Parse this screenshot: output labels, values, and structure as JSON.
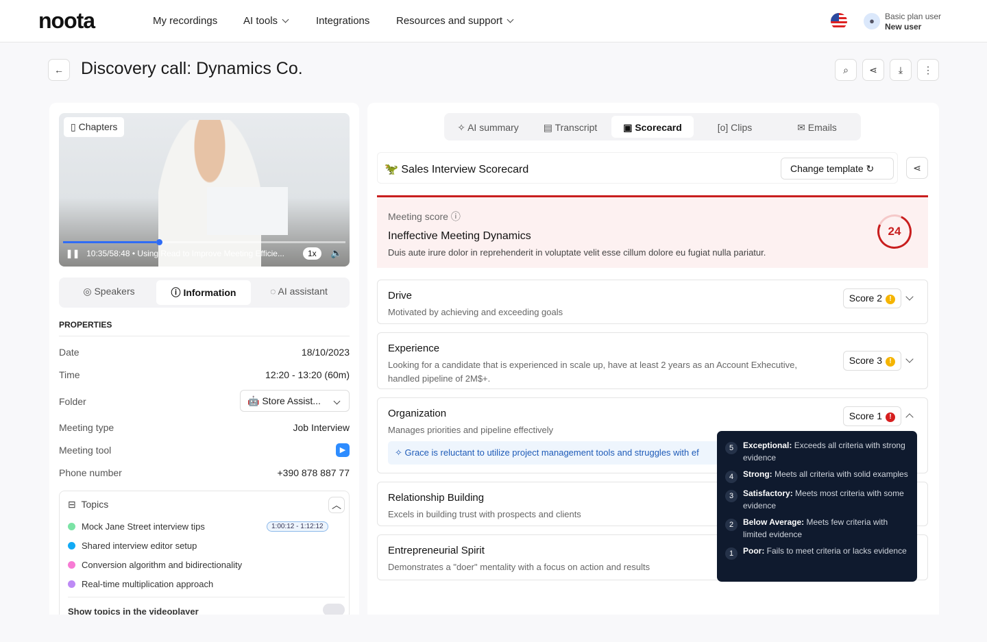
{
  "brand": {
    "logo": "noota"
  },
  "nav": {
    "items": [
      {
        "label": "My recordings"
      },
      {
        "label": "AI tools"
      },
      {
        "label": "Integrations"
      },
      {
        "label": "Resources and support"
      }
    ]
  },
  "user": {
    "plan": "Basic plan user",
    "name": "New user"
  },
  "page": {
    "title": "Discovery call: Dynamics Co."
  },
  "video": {
    "chapters_label": "Chapters",
    "time": "10:35/58:48",
    "separator": "•",
    "chapter_title": "Using Read to Improve Meeting Efficie...",
    "speed": "1x",
    "progress_percent": 33
  },
  "left_tabs": [
    {
      "label": "Speakers"
    },
    {
      "label": "Information"
    },
    {
      "label": "AI assistant"
    }
  ],
  "properties": {
    "heading": "PROPERTIES",
    "rows": [
      {
        "label": "Date",
        "value": "18/10/2023"
      },
      {
        "label": "Time",
        "value": "12:20 - 13:20 (60m)"
      },
      {
        "label": "Folder",
        "value": "Store Assist..."
      },
      {
        "label": "Meeting type",
        "value": "Job Interview"
      },
      {
        "label": "Meeting tool",
        "value": "zoom"
      },
      {
        "label": "Phone number",
        "value": "+390 878 887 77"
      }
    ]
  },
  "topics": {
    "title": "Topics",
    "items": [
      {
        "label": "Mock Jane Street interview tips",
        "color": "#7be3a5",
        "time": "1:00:12 - 1:12:12"
      },
      {
        "label": "Shared interview editor setup",
        "color": "#12aaf5"
      },
      {
        "label": "Conversion algorithm and bidirectionality",
        "color": "#f77bd4"
      },
      {
        "label": "Real-time multiplication approach",
        "color": "#bd8af5"
      }
    ],
    "show_label": "Show topics in the videoplayer",
    "show_enabled": false
  },
  "right_tabs": [
    {
      "label": "AI summary"
    },
    {
      "label": "Transcript"
    },
    {
      "label": "Scorecard",
      "active": true
    },
    {
      "label": "Clips"
    },
    {
      "label": "Emails"
    }
  ],
  "scorecard": {
    "title": "Sales Interview Scorecard",
    "change_template": "Change template",
    "meeting": {
      "label": "Meeting score",
      "headline": "Ineffective Meeting Dynamics",
      "description": "Duis aute irure dolor in reprehenderit in voluptate velit esse cillum dolore eu fugiat nulla pariatur.",
      "score": "24",
      "color": "#c81e1e"
    },
    "criteria": [
      {
        "name": "Drive",
        "description": "Motivated by achieving and exceeding goals",
        "score": "Score 2",
        "level": "warning"
      },
      {
        "name": "Experience",
        "description": "Looking for a candidate that is experienced in scale up, have at least 2 years as an Account Exhecutive, handled pipeline of 2M$+.",
        "score": "Score 3",
        "level": "warning"
      },
      {
        "name": "Organization",
        "description": "Manages priorities and pipeline effectively",
        "score": "Score 1",
        "level": "error",
        "evidence": "Grace is reluctant to utilize project management tools and struggles with ef"
      },
      {
        "name": "Relationship Building",
        "description": "Excels in building trust with prospects and clients"
      },
      {
        "name": "Entrepreneurial Spirit",
        "description": "Demonstrates a \"doer\" mentality with a focus on action and results"
      }
    ]
  },
  "tooltip": [
    {
      "n": "5",
      "title": "Exceptional:",
      "text": " Exceeds all criteria with strong evidence"
    },
    {
      "n": "4",
      "title": "Strong:",
      "text": " Meets all criteria with solid examples"
    },
    {
      "n": "3",
      "title": "Satisfactory:",
      "text": " Meets most criteria with some evidence"
    },
    {
      "n": "2",
      "title": "Below Average:",
      "text": " Meets few criteria with limited evidence"
    },
    {
      "n": "1",
      "title": "Poor:",
      "text": " Fails to meet criteria or lacks evidence"
    }
  ],
  "colors": {
    "accent": "#2f6cf5",
    "warning": "#f5b400",
    "error": "#d61f1f",
    "tooltip_bg": "#0f1a2e"
  }
}
